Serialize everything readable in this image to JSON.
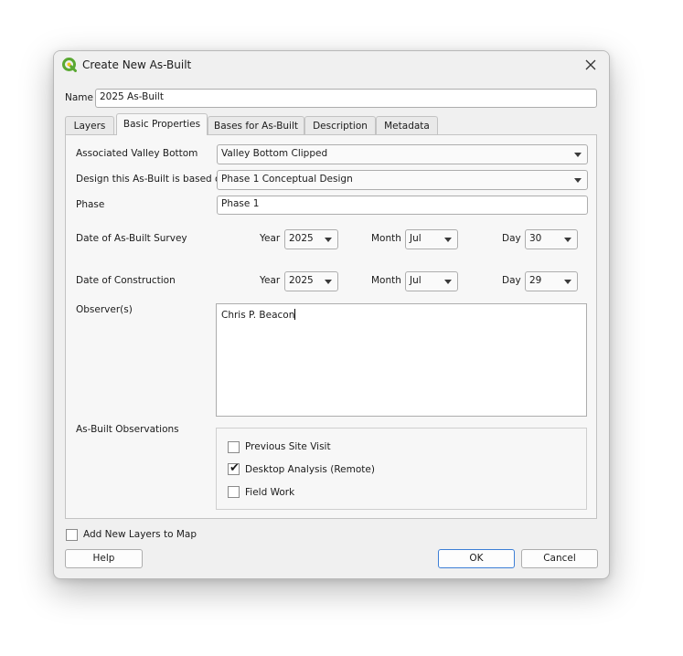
{
  "window": {
    "title": "Create New As-Built"
  },
  "name_field": {
    "label": "Name",
    "value": "2025 As-Built"
  },
  "tabs": [
    {
      "label": "Layers"
    },
    {
      "label": "Basic Properties"
    },
    {
      "label": "Bases for As-Built"
    },
    {
      "label": "Description"
    },
    {
      "label": "Metadata"
    }
  ],
  "basic_properties": {
    "valley_bottom": {
      "label": "Associated Valley Bottom",
      "value": "Valley Bottom Clipped"
    },
    "design": {
      "label": "Design this As-Built is based on",
      "value": "Phase 1 Conceptual Design"
    },
    "phase": {
      "label": "Phase",
      "value": "Phase 1"
    },
    "survey_date": {
      "label": "Date of As-Built Survey",
      "year_label": "Year",
      "year": "2025",
      "month_label": "Month",
      "month": "Jul",
      "day_label": "Day",
      "day": "30"
    },
    "construction_date": {
      "label": "Date of Construction",
      "year_label": "Year",
      "year": "2025",
      "month_label": "Month",
      "month": "Jul",
      "day_label": "Day",
      "day": "29"
    },
    "observers": {
      "label": "Observer(s)",
      "value": "Chris P. Beacon"
    },
    "observations": {
      "label": "As-Built Observations",
      "options": [
        {
          "label": "Previous Site Visit",
          "checked": false
        },
        {
          "label": "Desktop Analysis (Remote)",
          "checked": true
        },
        {
          "label": "Field Work",
          "checked": false
        }
      ]
    }
  },
  "add_layers": {
    "label": "Add New Layers to Map",
    "checked": false
  },
  "buttons": {
    "help": "Help",
    "ok": "OK",
    "cancel": "Cancel"
  },
  "colors": {
    "accent": "#3d7fd6",
    "qgis_green": "#5aa832"
  }
}
